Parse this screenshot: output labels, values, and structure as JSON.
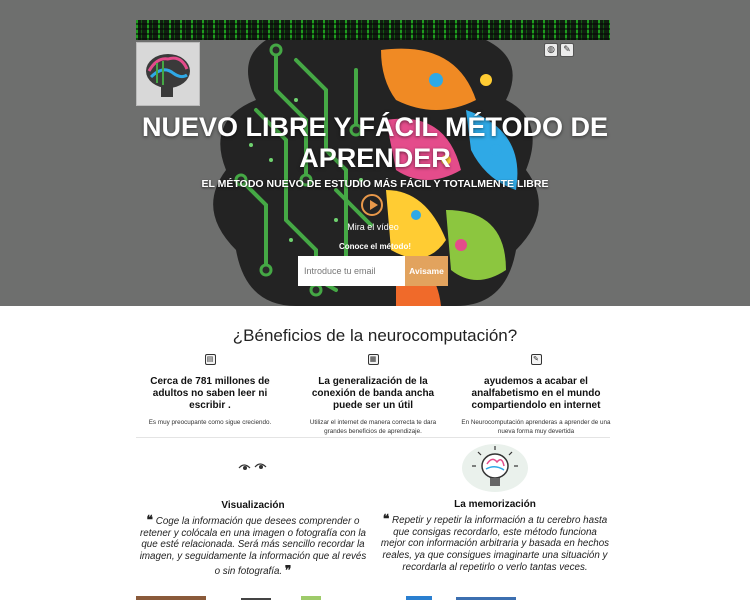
{
  "hero": {
    "title": "NUEVO LIBRE Y FÁCIL MÉTODO DE APRENDER",
    "subtitle": "EL MÉTODO NUEVO DE ESTUDIO MÁS FÁCIL Y TOTALMENTE LIBRE",
    "video_label": "Mira el vídeo",
    "cta_label": "Conoce el método!",
    "email_placeholder": "Introduce tu email",
    "notify_label": "Avisame"
  },
  "social": {
    "icons": [
      "globe-icon",
      "twitter-icon"
    ]
  },
  "benefits": {
    "title": "¿Béneficios de la neurocomputación?",
    "items": [
      {
        "icon": "book-icon",
        "title": "Cerca de 781 millones de adultos no saben leer ni escribir .",
        "text": "Es muy preocupante como sigue creciendo."
      },
      {
        "icon": "network-icon",
        "title": "La generalización de la conexión de banda ancha puede ser un útil",
        "text": "Utilizar el internet de manera correcta te dara grandes beneficios de aprendizaje."
      },
      {
        "icon": "pencil-icon",
        "title": "ayudemos a acabar el analfabetismo en el mundo compartiendolo en internet",
        "text": "En Neurocomputación aprenderas a aprender de una nueva forma muy devertida"
      }
    ]
  },
  "features": [
    {
      "title": "Visualización",
      "text": "Coge la información que desees comprender o retener y colócala en una imagen o fotografía con la que esté relacionada. Será más sencillo recordar la imagen, y seguidamente la información que al revés o sin fotografía."
    },
    {
      "title": "La memorización",
      "text": "Repetir y repetir la información a tu cerebro hasta que consigas recordarlo, este método funciona mejor con información arbitraria y basada en hechos reales, ya que consigues imaginarte una situación y recordarla al repetirlo o verlo tantas veces."
    }
  ],
  "colors": {
    "hero_bg": "#6e6f6e",
    "accent": "#e2a35e",
    "circuit_green": "#3d9a3d"
  }
}
